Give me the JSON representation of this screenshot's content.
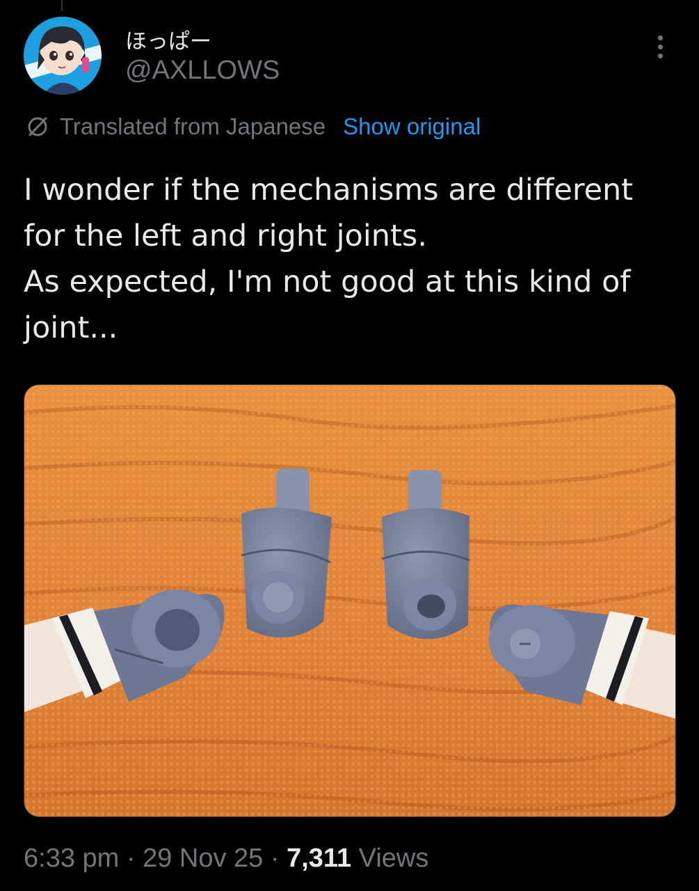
{
  "author": {
    "display_name": "ほっぱー",
    "handle": "@AXLLOWS",
    "avatar_icon": "anime-character-avatar"
  },
  "menu": {
    "icon": "more-options-icon"
  },
  "translation": {
    "icon": "globe-icon",
    "label": "Translated from Japanese",
    "action_label": "Show original",
    "action_color": "#1d9bf0"
  },
  "tweet": {
    "lines": [
      "I wonder if the mechanisms are different",
      "for the left and right joints.",
      "As expected, I'm not good at this kind of",
      "joint..."
    ]
  },
  "media": {
    "type": "photo"
  },
  "meta": {
    "time": "6:33 pm",
    "separator": " · ",
    "date": "29 Nov 25",
    "views_count": "7,311",
    "views_label": " Views"
  },
  "colors": {
    "background": "#000000",
    "primary_text": "#e7e9ea",
    "secondary_text": "#71767b",
    "accent": "#1d9bf0"
  }
}
